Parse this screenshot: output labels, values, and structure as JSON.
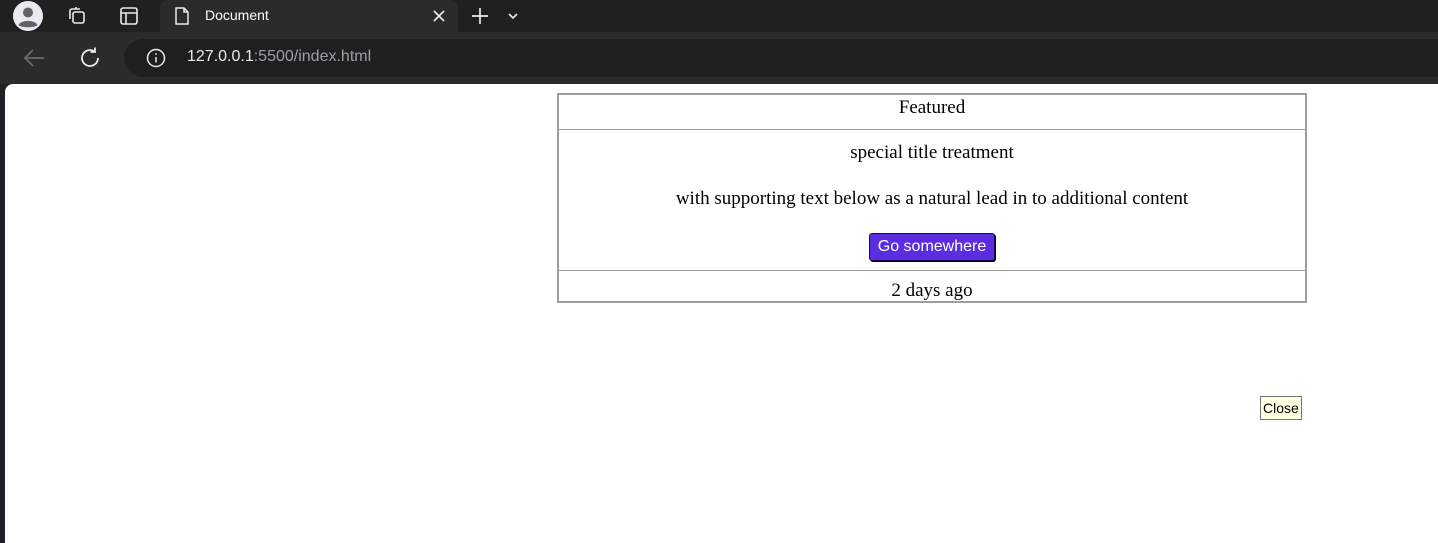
{
  "browser": {
    "tab_title": "Document",
    "url_host": "127.0.0.1",
    "url_rest": ":5500/index.html"
  },
  "card": {
    "header": "Featured",
    "title": "special title treatment",
    "text": "with supporting text below as a natural lead in to additional content",
    "button_label": "Go somewhere",
    "button_color": "#5b2de0",
    "footer": "2 days ago"
  },
  "close_label": "Close"
}
